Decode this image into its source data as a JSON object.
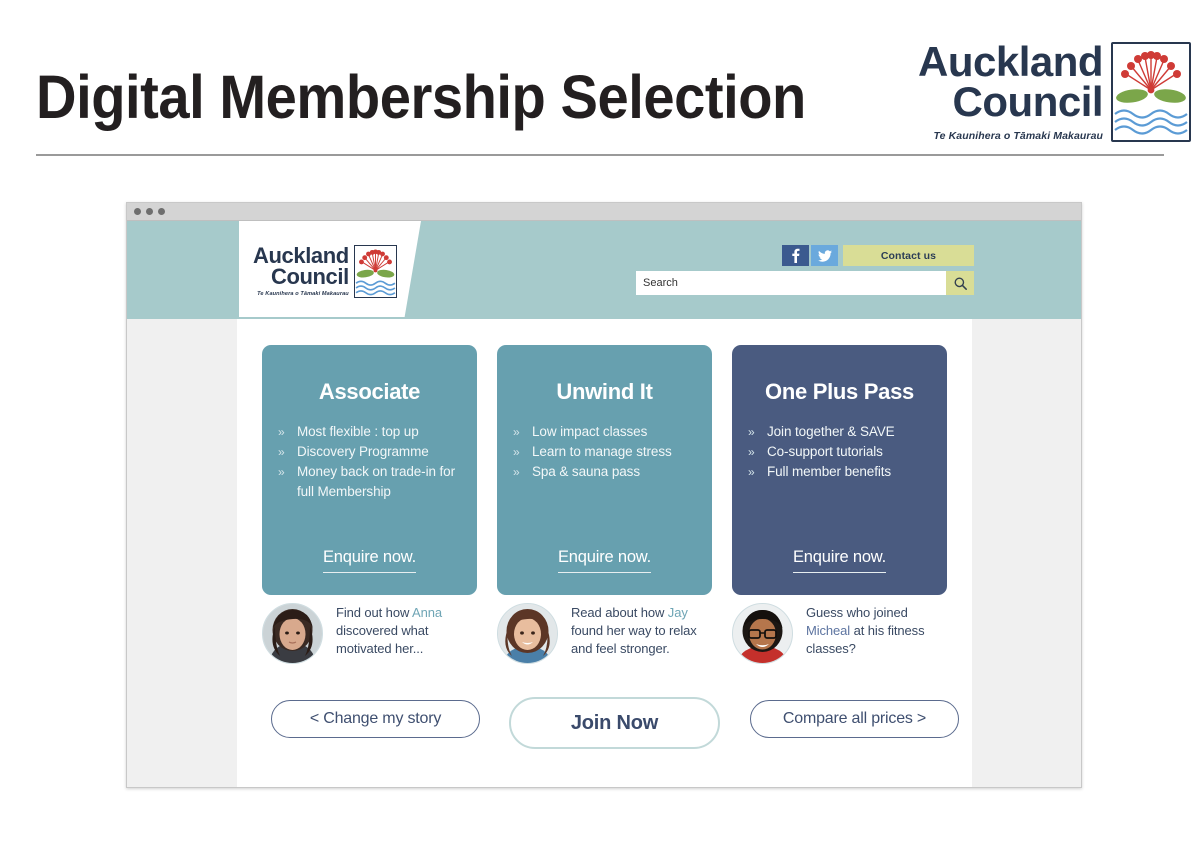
{
  "slide": {
    "title": "Digital Membership Selection"
  },
  "brand": {
    "line1": "Auckland",
    "line2": "Council",
    "maori": "Te Kaunihera o Tāmaki Makaurau",
    "navy": "#28374f",
    "flower_red": "#cf3b36",
    "leaf_green": "#7ba64a",
    "wave_blue": "#5b9bd5"
  },
  "browser": {
    "window_dots": 3
  },
  "site_header": {
    "social": [
      {
        "name": "facebook",
        "glyph": "f",
        "color": "#3b5a8f"
      },
      {
        "name": "twitter",
        "glyph": "twitter-bird",
        "color": "#6aa9dd"
      }
    ],
    "contact_label": "Contact us",
    "contact_color": "#d9dd96",
    "search": {
      "placeholder": "Search",
      "value": "",
      "button_icon": "search-icon"
    },
    "band_color": "#a6cacb"
  },
  "plans": [
    {
      "title": "Associate",
      "theme": "teal",
      "color": "#67a0af",
      "bullets": [
        "Most flexible : top up",
        "Discovery Programme",
        "Money back on trade-in for full Membership"
      ],
      "cta": "Enquire now."
    },
    {
      "title": "Unwind It",
      "theme": "teal",
      "color": "#67a0af",
      "bullets": [
        "Low impact classes",
        "Learn to manage stress",
        "Spa & sauna pass"
      ],
      "cta": "Enquire now."
    },
    {
      "title": "One Plus Pass",
      "theme": "navy",
      "color": "#4a5b80",
      "bullets": [
        "Join together & SAVE",
        "Co-support tutorials",
        "Full member benefits"
      ],
      "cta": "Enquire now."
    }
  ],
  "stories": [
    {
      "avatar": "woman-dark-hair-photo",
      "before": "Find out how ",
      "name": "Anna",
      "after": " discovered what motivated her...",
      "name_color": "#6fa5b5"
    },
    {
      "avatar": "woman-smiling-photo",
      "before": "Read about how ",
      "name": "Jay",
      "after": " found her way to relax and feel stronger.",
      "name_color": "#6fa5b5"
    },
    {
      "avatar": "man-glasses-photo",
      "before": "Guess who joined ",
      "name": "Micheal",
      "after": " at his fitness classes?",
      "name_color": "#5d74a0"
    }
  ],
  "actions": {
    "change_story": "<  Change my story",
    "join_now": "Join Now",
    "compare_prices": "Compare all prices  >"
  }
}
